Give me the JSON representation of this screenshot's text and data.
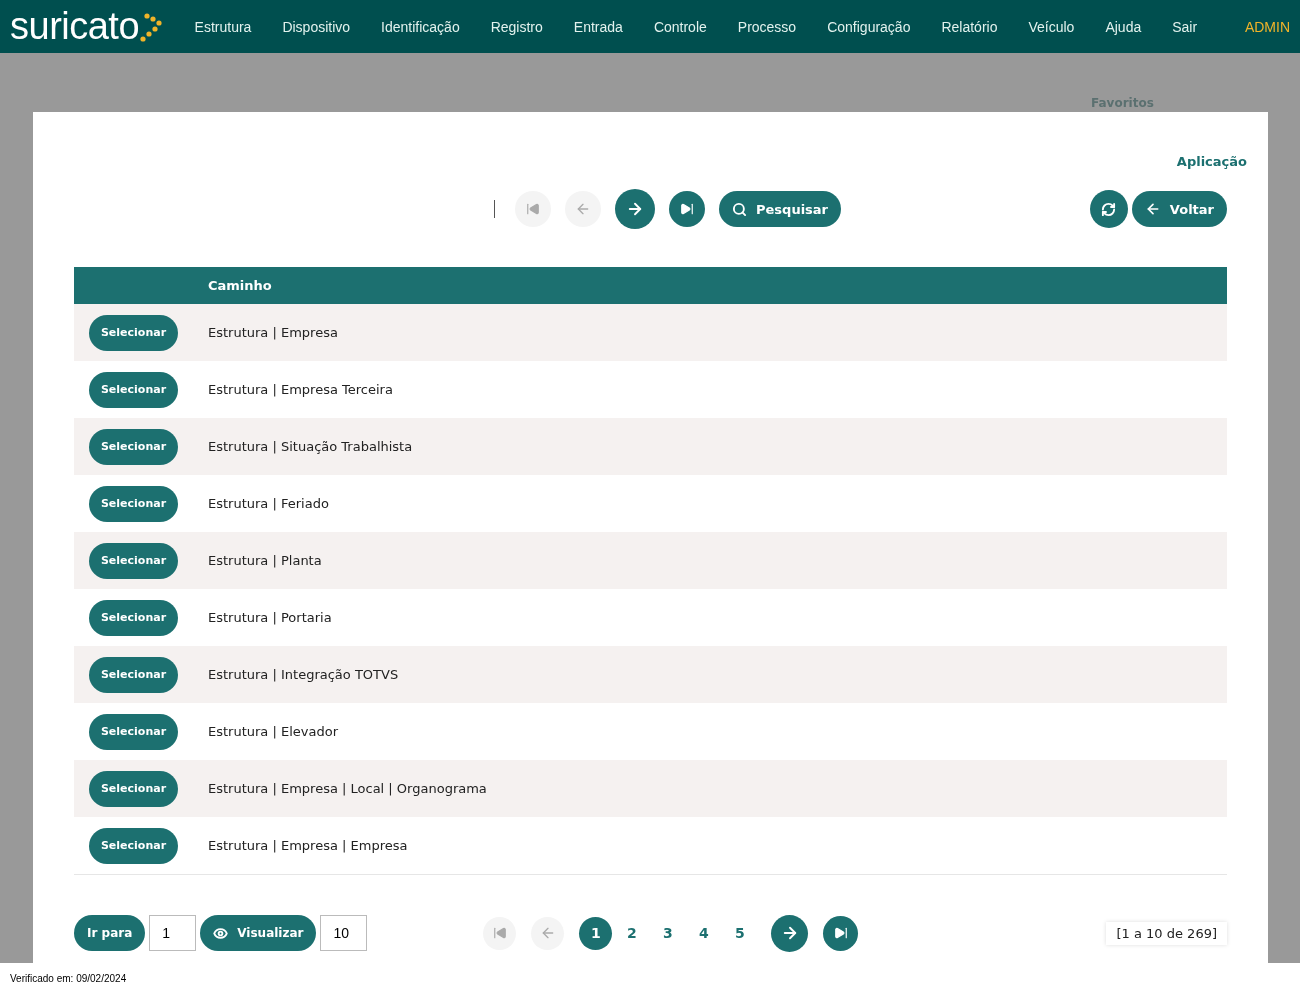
{
  "header": {
    "logo": "suricato",
    "menu": [
      "Estrutura",
      "Dispositivo",
      "Identificação",
      "Registro",
      "Entrada",
      "Controle",
      "Processo",
      "Configuração",
      "Relatório",
      "Veículo",
      "Ajuda",
      "Sair"
    ],
    "user": "ADMIN"
  },
  "favorites": "Favoritos",
  "title": "Aplicação",
  "toolbar": {
    "nav": [
      {
        "kind": "first",
        "disabled": true
      },
      {
        "kind": "prev",
        "disabled": true
      },
      {
        "kind": "next",
        "disabled": false
      },
      {
        "kind": "last",
        "disabled": false
      }
    ],
    "search": "Pesquisar",
    "back": "Voltar"
  },
  "table": {
    "columns": [
      "Caminho"
    ],
    "rows": [
      {
        "action": "Selecionar",
        "path": "Estrutura | Empresa"
      },
      {
        "action": "Selecionar",
        "path": "Estrutura | Empresa Terceira"
      },
      {
        "action": "Selecionar",
        "path": "Estrutura | Situação Trabalhista"
      },
      {
        "action": "Selecionar",
        "path": "Estrutura | Feriado"
      },
      {
        "action": "Selecionar",
        "path": "Estrutura | Planta"
      },
      {
        "action": "Selecionar",
        "path": "Estrutura | Portaria"
      },
      {
        "action": "Selecionar",
        "path": "Estrutura | Integração TOTVS"
      },
      {
        "action": "Selecionar",
        "path": "Estrutura | Elevador"
      },
      {
        "action": "Selecionar",
        "path": "Estrutura | Empresa | Local | Organograma"
      },
      {
        "action": "Selecionar",
        "path": "Estrutura | Empresa | Empresa"
      }
    ]
  },
  "pagination": {
    "goto_label": "Ir para",
    "goto_value": "1",
    "view_label": "Visualizar",
    "view_value": "10",
    "nav": [
      {
        "kind": "first",
        "disabled": true
      },
      {
        "kind": "prev",
        "disabled": true
      },
      {
        "kind": "next",
        "disabled": false
      },
      {
        "kind": "last",
        "disabled": false
      }
    ],
    "pages": [
      {
        "label": "1",
        "selected": true
      },
      {
        "label": "2",
        "selected": false
      },
      {
        "label": "3",
        "selected": false
      },
      {
        "label": "4",
        "selected": false
      },
      {
        "label": "5",
        "selected": false
      }
    ],
    "range": "[1 a 10 de 269]"
  },
  "footer": "Verificado em: 09/02/2024"
}
